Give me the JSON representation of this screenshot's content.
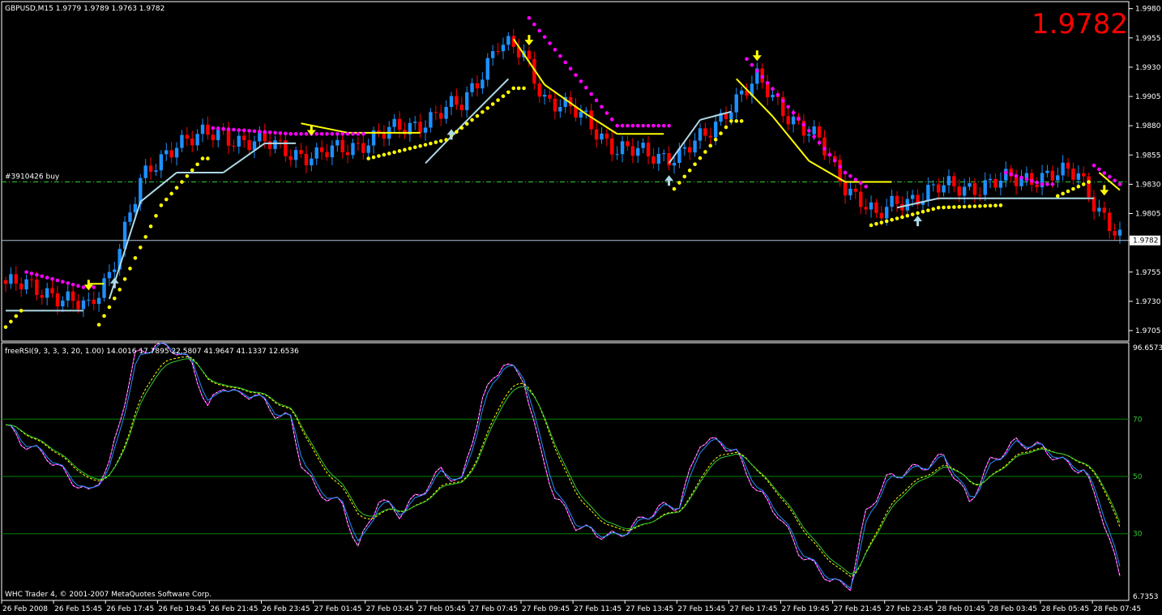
{
  "chart_data": [
    {
      "type": "candlestick",
      "symbol_header": "GBPUSD,M15  1.9779 1.9789 1.9763 1.9782",
      "big_price": "1.9782",
      "order_label": "#3910426 buy",
      "order_level": 1.9832,
      "current_price_label": "1.9782",
      "current_price": 1.9782,
      "ylim": [
        1.9696,
        1.9986
      ],
      "ticks": [
        "1.9980",
        "1.9955",
        "1.9930",
        "1.9905",
        "1.9880",
        "1.9855",
        "1.9830",
        "1.9805",
        "1.9782",
        "1.9755",
        "1.9730",
        "1.9705"
      ],
      "x_labels": [
        "26 Feb 2008",
        "26 Feb 15:45",
        "26 Feb 17:45",
        "26 Feb 19:45",
        "26 Feb 21:45",
        "26 Feb 23:45",
        "27 Feb 01:45",
        "27 Feb 03:45",
        "27 Feb 05:45",
        "27 Feb 07:45",
        "27 Feb 09:45",
        "27 Feb 11:45",
        "27 Feb 13:45",
        "27 Feb 15:45",
        "27 Feb 17:45",
        "27 Feb 19:45",
        "27 Feb 21:45",
        "27 Feb 23:45",
        "28 Feb 01:45",
        "28 Feb 03:45",
        "28 Feb 05:45",
        "28 Feb 07:45"
      ],
      "up_color": "#1e90ff",
      "down_color": "#ff0000",
      "close_anchors": [
        [
          0,
          1.9745
        ],
        [
          9,
          1.9738
        ],
        [
          16,
          1.9722
        ],
        [
          20,
          1.9755
        ],
        [
          26,
          1.983
        ],
        [
          33,
          1.9868
        ],
        [
          42,
          1.9872
        ],
        [
          52,
          1.9862
        ],
        [
          60,
          1.9853
        ],
        [
          68,
          1.9865
        ],
        [
          78,
          1.988
        ],
        [
          88,
          1.9898
        ],
        [
          95,
          1.995
        ],
        [
          100,
          1.994
        ],
        [
          104,
          1.9905
        ],
        [
          112,
          1.9885
        ],
        [
          118,
          1.986
        ],
        [
          124,
          1.9855
        ],
        [
          130,
          1.9855
        ],
        [
          135,
          1.987
        ],
        [
          140,
          1.99
        ],
        [
          145,
          1.9918
        ],
        [
          150,
          1.9895
        ],
        [
          157,
          1.9865
        ],
        [
          162,
          1.983
        ],
        [
          165,
          1.9818
        ],
        [
          168,
          1.98
        ],
        [
          172,
          1.9815
        ],
        [
          180,
          1.9826
        ],
        [
          190,
          1.983
        ],
        [
          200,
          1.9838
        ],
        [
          207,
          1.9838
        ],
        [
          211,
          1.981
        ],
        [
          215,
          1.9782
        ]
      ],
      "supertrend": [
        [
          0,
          1.9722,
          "#add8e6"
        ],
        [
          15,
          1.9722,
          "#add8e6"
        ],
        [
          16,
          1.9745,
          "#ffff00"
        ],
        [
          19,
          1.9745,
          "#ffff00"
        ],
        [
          20,
          1.9732,
          "#add8e6"
        ],
        [
          26,
          1.9815,
          "#add8e6"
        ],
        [
          33,
          1.984,
          "#add8e6"
        ],
        [
          42,
          1.984,
          "#add8e6"
        ],
        [
          50,
          1.9865,
          "#add8e6"
        ],
        [
          56,
          1.9865,
          "#add8e6"
        ],
        [
          57,
          1.9882,
          "#ffff00"
        ],
        [
          66,
          1.9874,
          "#ffff00"
        ],
        [
          80,
          1.9874,
          "#ffff00"
        ],
        [
          81,
          1.9848,
          "#add8e6"
        ],
        [
          88,
          1.988,
          "#add8e6"
        ],
        [
          97,
          1.992,
          "#add8e6"
        ],
        [
          98,
          1.9954,
          "#ffff00"
        ],
        [
          104,
          1.9915,
          "#ffff00"
        ],
        [
          112,
          1.989,
          "#ffff00"
        ],
        [
          118,
          1.9873,
          "#ffff00"
        ],
        [
          127,
          1.9873,
          "#ffff00"
        ],
        [
          128,
          1.9848,
          "#add8e6"
        ],
        [
          134,
          1.9885,
          "#add8e6"
        ],
        [
          140,
          1.9892,
          "#add8e6"
        ],
        [
          141,
          1.992,
          "#ffff00"
        ],
        [
          148,
          1.9888,
          "#ffff00"
        ],
        [
          155,
          1.985,
          "#ffff00"
        ],
        [
          162,
          1.9832,
          "#ffff00"
        ],
        [
          171,
          1.9832,
          "#ffff00"
        ],
        [
          172,
          1.981,
          "#add8e6"
        ],
        [
          180,
          1.9818,
          "#add8e6"
        ],
        [
          210,
          1.9818,
          "#add8e6"
        ],
        [
          211,
          1.984,
          "#ffff00"
        ],
        [
          215,
          1.9825,
          "#ffff00"
        ]
      ],
      "parabolic_sar": [
        [
          0,
          1.9708,
          "#ffff00"
        ],
        [
          3,
          1.9722,
          "#ffff00"
        ],
        [
          4,
          1.9755,
          "#ff00ff"
        ],
        [
          15,
          1.9742,
          "#ff00ff"
        ],
        [
          18,
          1.971,
          "#ffff00"
        ],
        [
          22,
          1.974,
          "#ffff00"
        ],
        [
          30,
          1.9812,
          "#ffff00"
        ],
        [
          38,
          1.9852,
          "#ffff00"
        ],
        [
          40,
          1.9878,
          "#ff00ff"
        ],
        [
          55,
          1.9873,
          "#ff00ff"
        ],
        [
          70,
          1.9852,
          "#ffff00"
        ],
        [
          85,
          1.9868,
          "#ffff00"
        ],
        [
          98,
          1.9912,
          "#ffff00"
        ],
        [
          101,
          1.9972,
          "#ff00ff"
        ],
        [
          118,
          1.988,
          "#ff00ff"
        ],
        [
          128,
          1.988,
          "#ff00ff"
        ],
        [
          129,
          1.9826,
          "#ffff00"
        ],
        [
          140,
          1.9884,
          "#ffff00"
        ],
        [
          143,
          1.9937,
          "#ff00ff"
        ],
        [
          162,
          1.984,
          "#ff00ff"
        ],
        [
          166,
          1.9828,
          "#ff00ff"
        ],
        [
          167,
          1.9795,
          "#ffff00"
        ],
        [
          180,
          1.981,
          "#ffff00"
        ],
        [
          192,
          1.9812,
          "#ffff00"
        ],
        [
          193,
          1.984,
          "#ff00ff"
        ],
        [
          200,
          1.983,
          "#ff00ff"
        ],
        [
          203,
          1.982,
          "#ffff00"
        ],
        [
          209,
          1.9832,
          "#ffff00"
        ],
        [
          210,
          1.9846,
          "#ff00ff"
        ],
        [
          215,
          1.983,
          "#ff00ff"
        ]
      ],
      "arrows": [
        [
          16,
          "down"
        ],
        [
          21,
          "up"
        ],
        [
          59,
          "down"
        ],
        [
          86,
          "up"
        ],
        [
          101,
          "down"
        ],
        [
          128,
          "up"
        ],
        [
          145,
          "down"
        ],
        [
          176,
          "up"
        ],
        [
          212,
          "down"
        ]
      ]
    },
    {
      "type": "line",
      "indicator_header": "freeRSI(9, 3, 3, 3, 20, 1.00) 14.0016 17.7895 22.5807 41.9647 41.1337 12.6536",
      "ylim": [
        6.7353,
        96.6573
      ],
      "top_label": "96.6573",
      "bottom_label": "6.7353",
      "levels": [
        {
          "value": 70,
          "label": "70"
        },
        {
          "value": 50,
          "label": "50"
        },
        {
          "value": 30,
          "label": "30"
        }
      ],
      "rsi_anchors": [
        [
          0,
          68
        ],
        [
          3,
          62
        ],
        [
          8,
          57
        ],
        [
          12,
          50
        ],
        [
          16,
          44
        ],
        [
          20,
          54
        ],
        [
          25,
          92
        ],
        [
          29,
          96
        ],
        [
          33,
          94
        ],
        [
          36,
          89
        ],
        [
          39,
          74
        ],
        [
          42,
          82
        ],
        [
          45,
          78
        ],
        [
          48,
          79
        ],
        [
          52,
          72
        ],
        [
          55,
          70
        ],
        [
          57,
          55
        ],
        [
          60,
          45
        ],
        [
          65,
          40
        ],
        [
          68,
          25
        ],
        [
          72,
          42
        ],
        [
          76,
          37
        ],
        [
          80,
          44
        ],
        [
          84,
          52
        ],
        [
          88,
          48
        ],
        [
          92,
          77
        ],
        [
          96,
          90
        ],
        [
          100,
          84
        ],
        [
          103,
          60
        ],
        [
          106,
          43
        ],
        [
          110,
          33
        ],
        [
          114,
          30
        ],
        [
          118,
          29
        ],
        [
          122,
          34
        ],
        [
          126,
          39
        ],
        [
          130,
          40
        ],
        [
          134,
          62
        ],
        [
          138,
          62
        ],
        [
          141,
          58
        ],
        [
          145,
          45
        ],
        [
          149,
          37
        ],
        [
          153,
          24
        ],
        [
          157,
          17
        ],
        [
          161,
          12
        ],
        [
          163,
          12
        ],
        [
          166,
          37
        ],
        [
          170,
          49
        ],
        [
          174,
          52
        ],
        [
          178,
          54
        ],
        [
          181,
          57
        ],
        [
          186,
          41
        ],
        [
          190,
          55
        ],
        [
          195,
          62
        ],
        [
          200,
          60
        ],
        [
          204,
          55
        ],
        [
          208,
          52
        ],
        [
          211,
          40
        ],
        [
          215,
          15
        ]
      ],
      "series": [
        {
          "name": "",
          "color": "#ffffff",
          "smooth": 0
        },
        {
          "name": "",
          "color": "#ff00ff",
          "smooth": 1
        },
        {
          "name": "",
          "color": "#1e90ff",
          "smooth": 2
        },
        {
          "name": "",
          "color": "#ffff00",
          "smooth": 8
        },
        {
          "name": "",
          "color": "#32cd32",
          "smooth": 9
        }
      ],
      "footer": "WHC Trader 4, © 2001-2007 MetaQuotes Software Corp."
    }
  ]
}
